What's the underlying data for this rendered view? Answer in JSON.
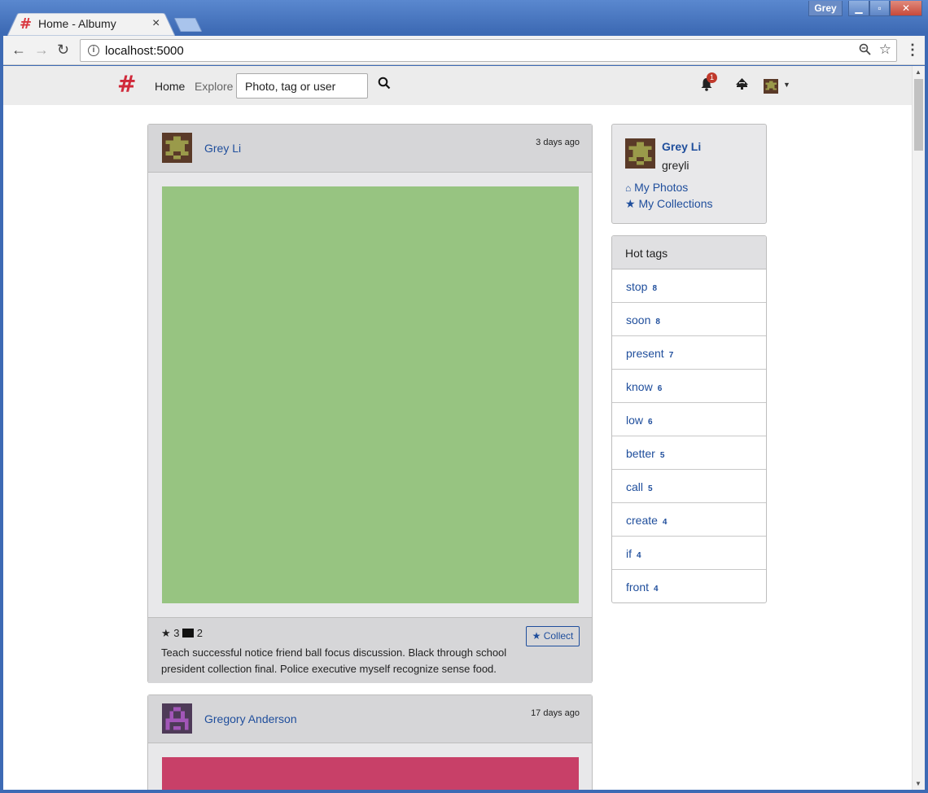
{
  "browser": {
    "tab_title": "Home - Albumy",
    "tab_favicon": "#",
    "tab_close": "×",
    "window_user": "Grey",
    "url": "localhost:5000"
  },
  "navbar": {
    "brand": "#",
    "home": "Home",
    "explore": "Explore",
    "search_placeholder": "Photo, tag or user",
    "notification_count": "1"
  },
  "feed": [
    {
      "user": "Grey Li",
      "time": "3 days ago",
      "photo_color": "#97c481",
      "collects": "3",
      "comments": "2",
      "description": "Teach successful notice friend ball focus discussion. Black through school president collection final. Police executive myself recognize sense food.",
      "collect_label": "Collect"
    },
    {
      "user": "Gregory Anderson",
      "time": "17 days ago",
      "photo_color": "#c84068"
    }
  ],
  "profile": {
    "name": "Grey Li",
    "username": "greyli",
    "links": [
      "My Photos",
      "My Collections"
    ]
  },
  "hot_tags": {
    "title": "Hot tags",
    "items": [
      {
        "name": "stop",
        "count": "8"
      },
      {
        "name": "soon",
        "count": "8"
      },
      {
        "name": "present",
        "count": "7"
      },
      {
        "name": "know",
        "count": "6"
      },
      {
        "name": "low",
        "count": "6"
      },
      {
        "name": "better",
        "count": "5"
      },
      {
        "name": "call",
        "count": "5"
      },
      {
        "name": "create",
        "count": "4"
      },
      {
        "name": "if",
        "count": "4"
      },
      {
        "name": "front",
        "count": "4"
      }
    ]
  }
}
